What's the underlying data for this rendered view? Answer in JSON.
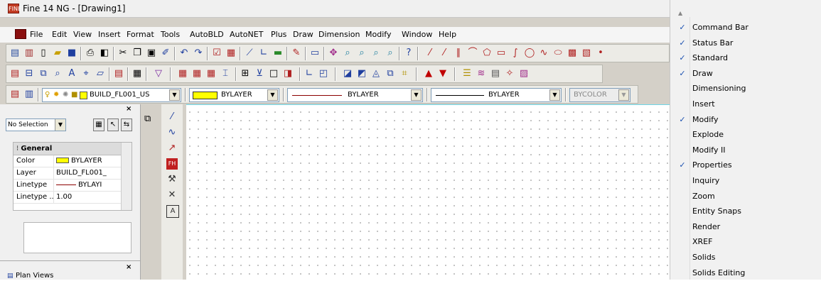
{
  "window": {
    "title": "Fine 14 NG  - [Drawing1]",
    "app_icon_label": "FINE"
  },
  "menubar": {
    "items": [
      "File",
      "Edit",
      "View",
      "Insert",
      "Format",
      "Tools",
      "AutoBLD",
      "AutoNET",
      "Plus",
      "Draw",
      "Dimension",
      "Modify",
      "Window",
      "Help"
    ]
  },
  "layer_bar": {
    "layer_combo": "BUILD_FL001_US",
    "color_combo": "BYLAYER",
    "linetype_combo": "BYLAYER",
    "lineweight_combo": "BYLAYER",
    "plotstyle_combo": "BYCOLOR"
  },
  "properties": {
    "selection": "No Selection",
    "section": "General",
    "rows": [
      {
        "key": "Color",
        "value": "BYLAYER"
      },
      {
        "key": "Layer",
        "value": "BUILD_FL001_"
      },
      {
        "key": "Linetype",
        "value": "BYLAYI"
      },
      {
        "key": "Linetype ...",
        "value": "1.00"
      }
    ]
  },
  "plan_views": {
    "title": "Plan Views"
  },
  "context_menu": {
    "items": [
      {
        "label": "Command Bar",
        "checked": true
      },
      {
        "label": "Status Bar",
        "checked": true
      },
      {
        "label": "Standard",
        "checked": true
      },
      {
        "label": "Draw",
        "checked": true
      },
      {
        "label": "Dimensioning",
        "checked": false
      },
      {
        "label": "Insert",
        "checked": false
      },
      {
        "label": "Modify",
        "checked": true
      },
      {
        "label": "Explode",
        "checked": false
      },
      {
        "label": "Modify II",
        "checked": false
      },
      {
        "label": "Properties",
        "checked": true
      },
      {
        "label": "Inquiry",
        "checked": false
      },
      {
        "label": "Zoom",
        "checked": false
      },
      {
        "label": "Entity Snaps",
        "checked": false
      },
      {
        "label": "Render",
        "checked": false
      },
      {
        "label": "XREF",
        "checked": false
      },
      {
        "label": "Solids",
        "checked": false
      },
      {
        "label": "Solids Editing",
        "checked": false
      }
    ]
  },
  "colors": {
    "checkmark": "#1a50b0",
    "canvas": "#ffffff",
    "linetype_sample": "#8b0000",
    "color_swatch": "#ffff00"
  }
}
